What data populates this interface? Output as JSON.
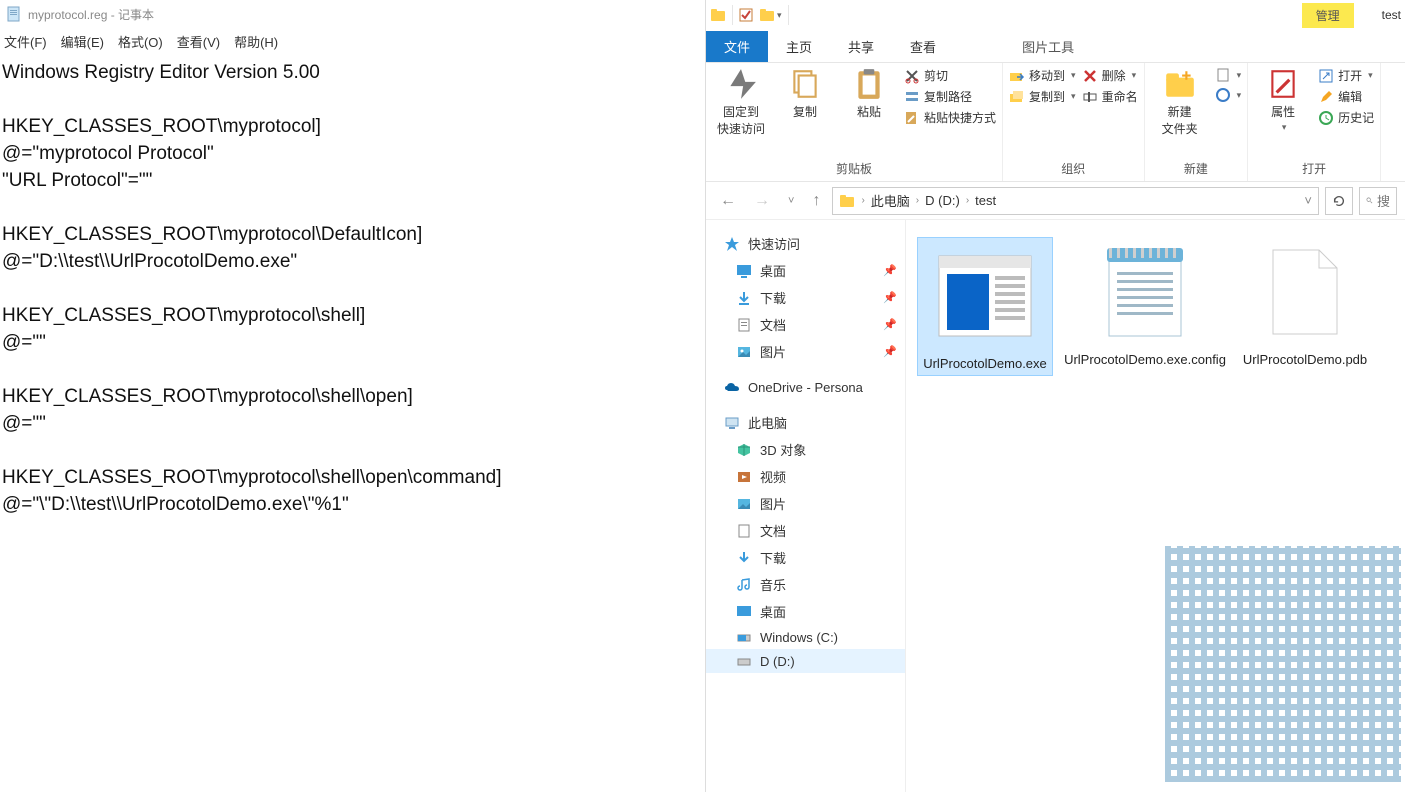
{
  "notepad": {
    "title": "myprotocol.reg - 记事本",
    "menu": {
      "file": "文件(F)",
      "edit": "编辑(E)",
      "format": "格式(O)",
      "view": "查看(V)",
      "help": "帮助(H)"
    },
    "content": "Windows Registry Editor Version 5.00\n\nHKEY_CLASSES_ROOT\\myprotocol]\n@=\"myprotocol Protocol\"\n\"URL Protocol\"=\"\"\n\nHKEY_CLASSES_ROOT\\myprotocol\\DefaultIcon]\n@=\"D:\\\\test\\\\UrlProcotolDemo.exe\"\n\nHKEY_CLASSES_ROOT\\myprotocol\\shell]\n@=\"\"\n\nHKEY_CLASSES_ROOT\\myprotocol\\shell\\open]\n@=\"\"\n\nHKEY_CLASSES_ROOT\\myprotocol\\shell\\open\\command]\n@=\"\\\"D:\\\\test\\\\UrlProcotolDemo.exe\\\"%1\""
  },
  "explorer": {
    "title_manage": "管理",
    "title_text": "test",
    "tabs": {
      "file": "文件",
      "home": "主页",
      "share": "共享",
      "view": "查看",
      "tools": "图片工具"
    },
    "ribbon": {
      "pin": "固定到\n快速访问",
      "copy": "复制",
      "paste": "粘贴",
      "cut": "剪切",
      "copypath": "复制路径",
      "pasteshortcut": "粘贴快捷方式",
      "moveto": "移动到",
      "copyto": "复制到",
      "delete": "删除",
      "rename": "重命名",
      "newfolder": "新建\n文件夹",
      "newitem": "",
      "props": "属性",
      "open": "打开",
      "edit": "编辑",
      "history": "历史记",
      "g_clip": "剪贴板",
      "g_org": "组织",
      "g_new": "新建",
      "g_open": "打开"
    },
    "breadcrumbs": [
      "此电脑",
      "D (D:)",
      "test"
    ],
    "search_placeholder": "搜",
    "nav": {
      "quick": "快速访问",
      "desktop": "桌面",
      "downloads": "下载",
      "documents": "文档",
      "pictures": "图片",
      "onedrive": "OneDrive - Persona",
      "thispc": "此电脑",
      "objects3d": "3D 对象",
      "videos": "视频",
      "pictures2": "图片",
      "documents2": "文档",
      "downloads2": "下载",
      "music": "音乐",
      "desktop2": "桌面",
      "cdrive": "Windows (C:)",
      "ddrive": "D (D:)"
    },
    "files": [
      {
        "name": "UrlProcotolDemo.exe",
        "type": "exe",
        "selected": true
      },
      {
        "name": "UrlProcotolDemo.exe.config",
        "type": "config",
        "selected": false
      },
      {
        "name": "UrlProcotolDemo.pdb",
        "type": "pdb",
        "selected": false
      }
    ]
  }
}
